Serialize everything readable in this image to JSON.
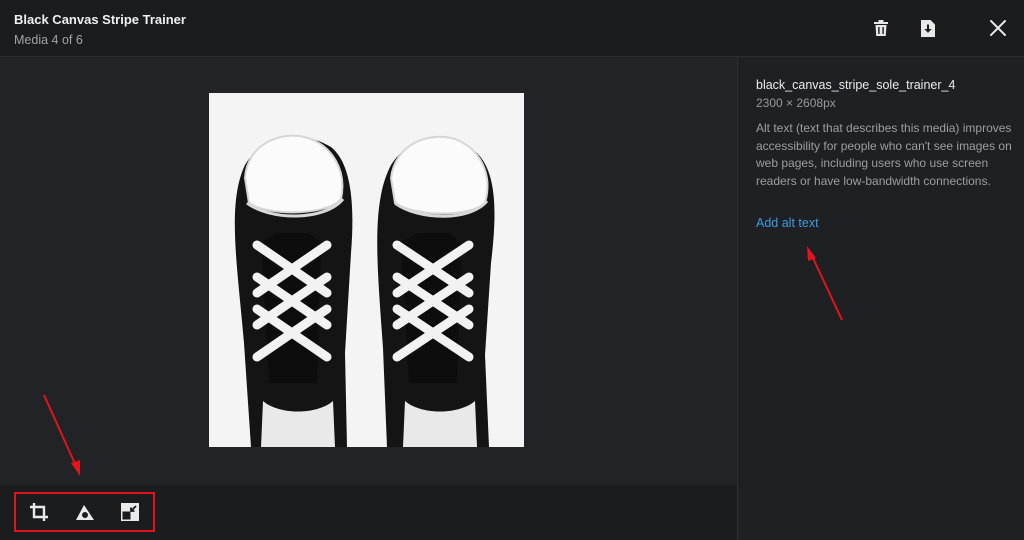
{
  "header": {
    "title": "Black Canvas Stripe Trainer",
    "subtitle": "Media 4 of 6",
    "actions": [
      {
        "icon": "trash-icon",
        "label": "Delete"
      },
      {
        "icon": "download-icon",
        "label": "Download"
      },
      {
        "icon": "close-icon",
        "label": "Close"
      }
    ]
  },
  "details": {
    "filename": "black_canvas_stripe_sole_trainer_4",
    "dimensions": "2300 × 2608px",
    "alt_description": "Alt text (text that describes this media) improves accessibility for people who can't see images on web pages, including users who use screen readers or have low-bandwidth connections.",
    "add_alt_text": "Add alt text"
  },
  "toolbar": {
    "tools": [
      {
        "icon": "crop-icon"
      },
      {
        "icon": "focal-point-icon"
      },
      {
        "icon": "resize-icon"
      }
    ]
  },
  "colors": {
    "accent_link": "#3d9ae0",
    "annotation_red": "#e3141b"
  }
}
